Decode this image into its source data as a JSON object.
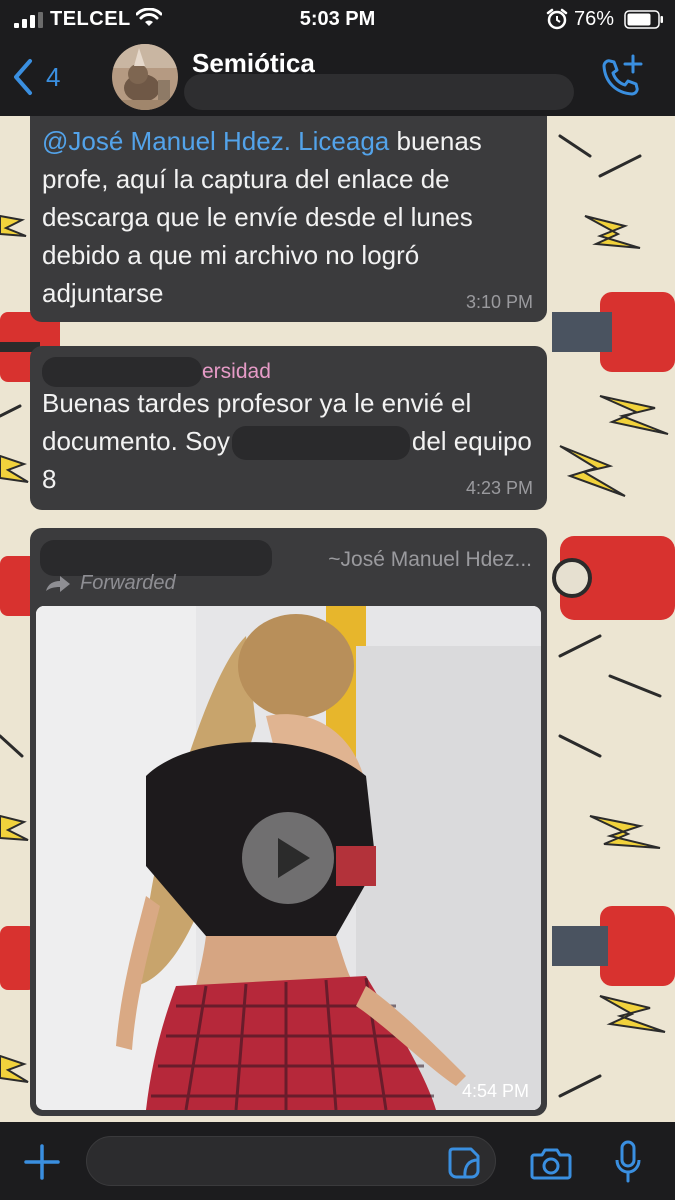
{
  "status_bar": {
    "carrier": "TELCEL",
    "time": "5:03 PM",
    "battery": "76%",
    "icons": [
      "signal-icon",
      "wifi-icon",
      "alarm-icon",
      "battery-icon"
    ]
  },
  "header": {
    "back_count": "4",
    "title": "Semiótica",
    "icons": [
      "chevron-left-icon",
      "add-call-icon"
    ]
  },
  "messages": [
    {
      "mention": "@José Manuel Hdez. Liceaga",
      "text": " buenas profe, aquí la captura del enlace de descarga que le envíe desde el lunes debido a que mi archivo no logró adjuntarse",
      "time": "3:10 PM"
    },
    {
      "sender_visible": "ersidad",
      "text_before": "Buenas tardes profesor ya le envié el documento. Soy",
      "text_after": "del equipo 8",
      "time": "4:23 PM"
    },
    {
      "forwarded_from": "~José Manuel Hdez...",
      "forwarded_label": "Forwarded",
      "media": "video",
      "time": "4:54 PM"
    }
  ],
  "input_bar": {
    "placeholder": "",
    "icons": [
      "plus-icon",
      "sticker-icon",
      "camera-icon",
      "microphone-icon"
    ]
  },
  "colors": {
    "bar_background": "#1c1c1e",
    "bubble_background": "#3b3b3d",
    "accent_blue": "#3a8fe0",
    "mention_blue": "#53a3ea",
    "sender_pink": "#e69bc7",
    "wallpaper": "#ece5d2"
  }
}
